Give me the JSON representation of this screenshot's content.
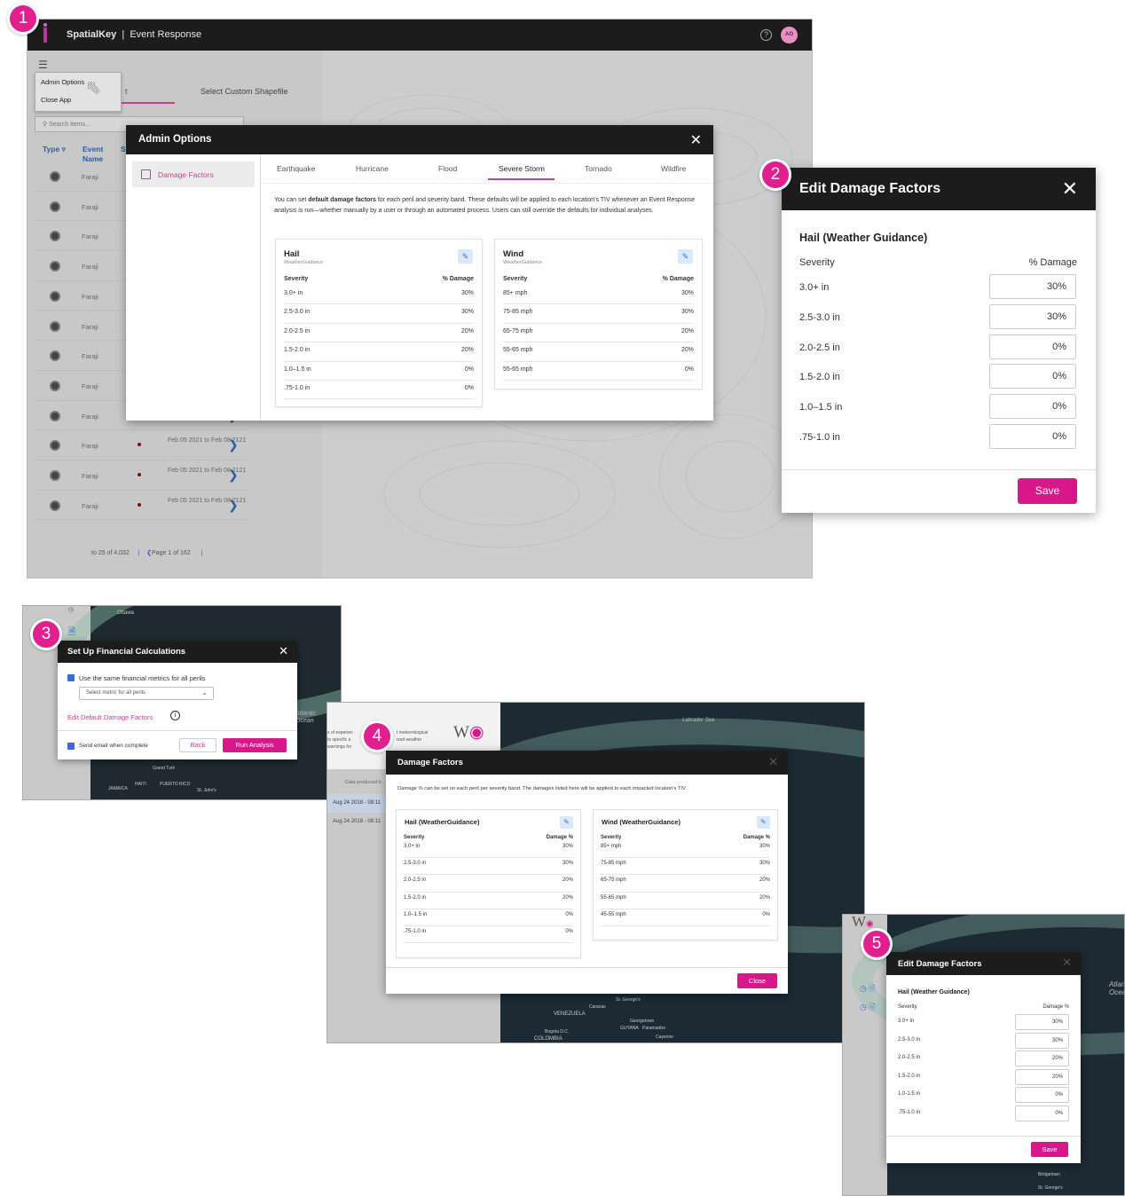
{
  "badges": [
    "1",
    "2",
    "3",
    "4",
    "5"
  ],
  "colors": {
    "accent": "#d7178a",
    "header": "#1c1c1c",
    "link_blue": "#2e5ea0"
  },
  "panel1": {
    "app_name": "SpatialKey",
    "app_section": "Event Response",
    "avatar": "AO",
    "menu": [
      "Admin Options",
      "Close App"
    ],
    "tab_partial": "t",
    "tab_custom": "Select Custom Shapefile",
    "search_placeholder": "Search items...",
    "col_type": "Type",
    "col_event": "Event Name",
    "col_partial": "S",
    "rows": [
      {
        "name": "Faraji",
        "date": ""
      },
      {
        "name": "Faraji",
        "date": ""
      },
      {
        "name": "Faraji",
        "date": ""
      },
      {
        "name": "Faraji",
        "date": ""
      },
      {
        "name": "Faraji",
        "date": ""
      },
      {
        "name": "Faraji",
        "date": ""
      },
      {
        "name": "Faraji",
        "date": ""
      },
      {
        "name": "Faraji",
        "date": ""
      },
      {
        "name": "Faraji",
        "date": "Feb 08 2121"
      },
      {
        "name": "Faraji",
        "date": "Feb 05 2021 to Feb 08 2121"
      },
      {
        "name": "Faraji",
        "date": "Feb 05 2021 to Feb 08 2121"
      },
      {
        "name": "Faraji",
        "date": "Feb 05 2021 to Feb 08 2121"
      }
    ],
    "pager": "to 25 of 4,032",
    "pager_page": "Page 1 of 162",
    "admin": {
      "title": "Admin Options",
      "side_item": "Damage Factors",
      "tabs": [
        "Earthquake",
        "Hurricane",
        "Flood",
        "Severe Storm",
        "Tornado",
        "Wildfire"
      ],
      "desc_pre": "You can set ",
      "desc_bold": "default damage factors",
      "desc_post": " for each peril and severity band. These defaults will be applied to each location's TIV whenever an Event Response analysis is run—whether manually by a user or through an automated process. Users can still override the defaults for individual analyses.",
      "hail": {
        "title": "Hail",
        "source": "WeatherGuidance",
        "col1": "Severity",
        "col2": "% Damage",
        "rows": [
          [
            "3.0+ in",
            "30%"
          ],
          [
            "2.5-3.0 in",
            "30%"
          ],
          [
            "2.0-2.5 in",
            "20%"
          ],
          [
            "1.5-2.0 in",
            "20%"
          ],
          [
            "1.0–1.5 in",
            "0%"
          ],
          [
            ".75-1.0 in",
            "0%"
          ]
        ]
      },
      "wind": {
        "title": "Wind",
        "source": "WeatherGuidance",
        "col1": "Severity",
        "col2": "% Damage",
        "rows": [
          [
            "85+ mph",
            "30%"
          ],
          [
            "75-85 mph",
            "30%"
          ],
          [
            "65-75 mph",
            "20%"
          ],
          [
            "55-65 mph",
            "20%"
          ],
          [
            "55-65 mph",
            "0%"
          ]
        ]
      }
    }
  },
  "panel2": {
    "title": "Edit Damage Factors",
    "subtitle": "Hail (Weather Guidance)",
    "col1": "Severity",
    "col2": "% Damage",
    "rows": [
      [
        "3.0+ in",
        "30%"
      ],
      [
        "2.5-3.0 in",
        "30%"
      ],
      [
        "2.0-2.5 in",
        "0%"
      ],
      [
        "1.5-2.0 in",
        "0%"
      ],
      [
        "1.0–1.5 in",
        "0%"
      ],
      [
        ".75-1.0 in",
        "0%"
      ]
    ],
    "save": "Save"
  },
  "panel3": {
    "title": "Set Up Financial Calculations",
    "same_metrics": "Use the same financial metrics for all perils",
    "select_placeholder": "Select metric for all perils",
    "edit_link": "Edit Default Damage Factors",
    "email": "Send email when complete",
    "back": "Back",
    "run": "Run Analysis",
    "map_labels": [
      "Ottawa",
      "Atlantic Ocean",
      "Grand Turk",
      "JAMAICA",
      "HAITI",
      "PUERTO RICO",
      "St. John's"
    ]
  },
  "panel4": {
    "data_produced": "Data produced b",
    "rows": [
      "Aug 24 2018 - 08:11",
      "Aug 24 2018 - 08:11"
    ],
    "left_text": [
      "s of experien",
      "to specific a",
      "warnings for"
    ],
    "left_text2": [
      "t meteorological",
      "ized weather"
    ],
    "map_labels": [
      "Labrador Sea",
      "Caracas",
      "VENEZUELA",
      "Bogota D.C.",
      "COLOMBIA",
      "St. George's",
      "Georgetown",
      "Paramaribo",
      "Cayenne",
      "GUYANA"
    ],
    "title": "Damage Factors",
    "desc": "Damage % can be set on each peril per severity band. The damages listed here will be applied to each impacted location's TIV.",
    "hail": {
      "title": "Hail (WeatherGuidance)",
      "col1": "Severity",
      "col2": "Damage %",
      "rows": [
        [
          "3.0+ in",
          "30%"
        ],
        [
          "2.5-3.0 in",
          "30%"
        ],
        [
          "2.0-2.5 in",
          "20%"
        ],
        [
          "1.5-2.0 in",
          "20%"
        ],
        [
          "1.0–1.5 in",
          "0%"
        ],
        [
          ".75-1.0 in",
          "0%"
        ]
      ]
    },
    "wind": {
      "title": "Wind (WeatherGuidance)",
      "col1": "Severity",
      "col2": "Damage %",
      "rows": [
        [
          "85+ mph",
          "30%"
        ],
        [
          "75-85 mph",
          "30%"
        ],
        [
          "65-75 mph",
          "20%"
        ],
        [
          "55-65 mph",
          "20%"
        ],
        [
          "45-55 mph",
          "0%"
        ]
      ]
    },
    "close": "Close"
  },
  "panel5": {
    "title": "Edit Damage Factors",
    "subtitle": "Hail (Weather Guidance)",
    "col1": "Severity",
    "col2": "Damage %",
    "rows": [
      [
        "3.0+ in",
        "30%"
      ],
      [
        "2.5-3.0 in",
        "30%"
      ],
      [
        "2.0-2.5 in",
        "20%"
      ],
      [
        "1.5-2.0 in",
        "20%"
      ],
      [
        "1.0-1.5 in",
        "0%"
      ],
      [
        ".75-1.0 in",
        "0%"
      ]
    ],
    "save": "Save",
    "map_labels": [
      "Atlantic Ocean",
      "Bridgetown",
      "St. George's"
    ]
  }
}
